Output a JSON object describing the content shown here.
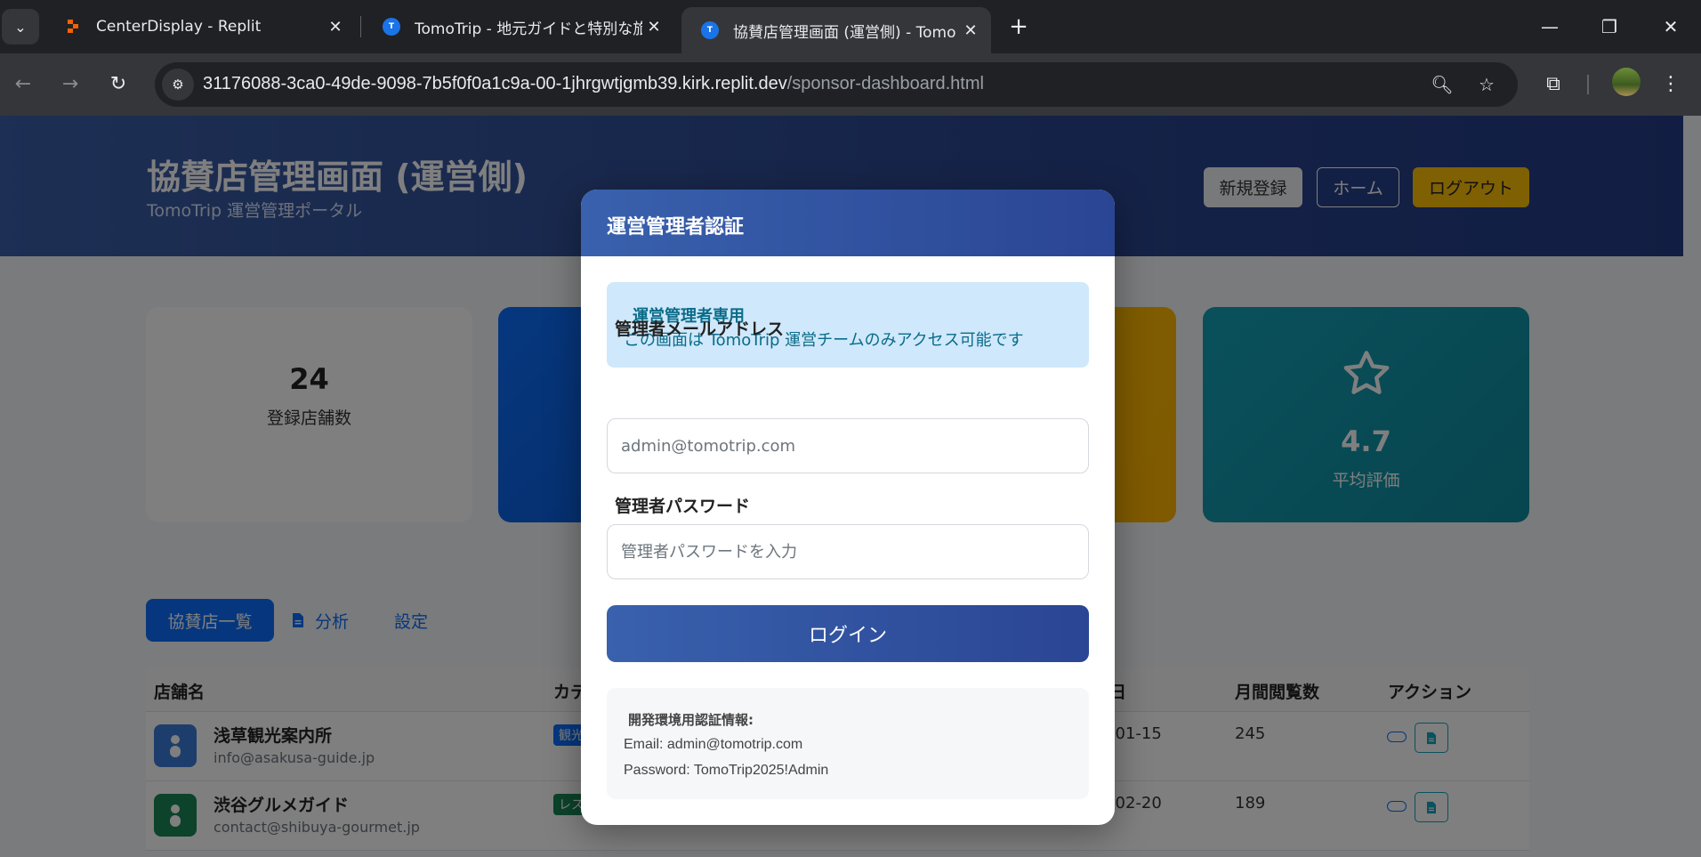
{
  "browser": {
    "tabs": [
      {
        "title": "CenterDisplay - Replit",
        "favicon": "replit-icon"
      },
      {
        "title": "TomoTrip - 地元ガイドと特別な旅",
        "favicon": "tomotrip-icon"
      },
      {
        "title": "協賛店管理画面 (運営側) - Tomo",
        "favicon": "tomotrip-icon",
        "active": true
      }
    ],
    "url_host": "31176088-3ca0-49de-9098-7b5f0f0a1c9a-00-1jhrgwtjgmb39.kirk.replit.dev",
    "url_path": "/sponsor-dashboard.html"
  },
  "header": {
    "title": "協賛店管理画面 (運営側)",
    "subtitle": "TomoTrip 運営管理ポータル",
    "new_label": "新規登録",
    "home_label": "ホーム",
    "logout_label": "ログアウト"
  },
  "stats": {
    "stores_count": "24",
    "stores_label": "登録店舗数",
    "rating_value": "4.7",
    "rating_label": "平均評価"
  },
  "page_tabs": {
    "list": "協賛店一覧",
    "analysis": "分析",
    "settings": "設定"
  },
  "table": {
    "headers": {
      "name": "店舗名",
      "category": "カテ",
      "date": "日",
      "views": "月間閲覧数",
      "actions": "アクション"
    },
    "rows": [
      {
        "name": "浅草観光案内所",
        "email": "info@asakusa-guide.jp",
        "badge": "観光",
        "badge_color": "#0d6efd",
        "avatar_color": "#3b7dd8",
        "date": "-01-15",
        "views": "245"
      },
      {
        "name": "渋谷グルメガイド",
        "email": "contact@shibuya-gourmet.jp",
        "badge": "レス",
        "badge_color": "#198754",
        "avatar_color": "#198754",
        "date": "-02-20",
        "views": "189"
      }
    ]
  },
  "modal": {
    "title": "運営管理者認証",
    "info_title": "運営管理者専用",
    "info_text": "この画面は TomoTrip 運営チームのみアクセス可能です",
    "email_label": "管理者メールアドレス",
    "email_placeholder": "admin@tomotrip.com",
    "password_label": "管理者パスワード",
    "password_placeholder": "管理者パスワードを入力",
    "login_label": "ログイン",
    "dev_title": "開発環境用認証情報:",
    "dev_email": "Email: admin@tomotrip.com",
    "dev_password": "Password: TomoTrip2025!Admin"
  },
  "colors": {
    "primary": "#0d6efd",
    "navy": "#2a4594",
    "warning": "#ffc107",
    "info": "#14a2b8"
  }
}
